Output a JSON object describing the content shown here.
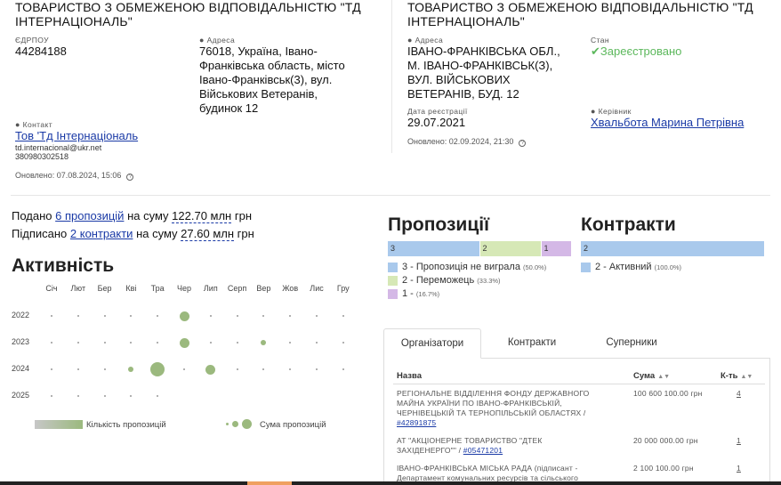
{
  "left_company": {
    "name_line1": "ТОВАРИСТВО З ОБМЕЖЕНОЮ ВІДПОВІДАЛЬНІСТЮ \"ТД",
    "name_line2": "ІНТЕРНАЦІОНАЛЬ\"",
    "edrpou_label": "ЄДРПОУ",
    "edrpou": "44284188",
    "address_label": "Адреса",
    "address_lines": [
      "76018, Україна, Івано-",
      "Франківська область, місто",
      "Івано-Франківськ(3), вул.",
      "Військових Ветеранів,",
      "будинок 12"
    ],
    "contact_label": "Контакт",
    "contact_name": "Тов 'Тд Інтернаціональ",
    "contact_email": "td.internacional@ukr.net",
    "contact_phone": "380980302518",
    "updated": "Оновлено: 07.08.2024, 15:06"
  },
  "right_company": {
    "name_line1": "ТОВАРИСТВО З ОБМЕЖЕНОЮ ВІДПОВІДАЛЬНІСТЮ \"ТД",
    "name_line2": "ІНТЕРНАЦІОНАЛЬ\"",
    "address_label": "Адреса",
    "address_lines": [
      "ІВАНО-ФРАНКІВСЬКА ОБЛ.,",
      "М. ІВАНО-ФРАНКІВСЬК(З),",
      "ВУЛ. ВІЙСЬКОВИХ",
      "ВЕТЕРАНІВ, БУД. 12"
    ],
    "status_label": "Стан",
    "status": "Зареєстровано",
    "reg_date_label": "Дата реєстрації",
    "reg_date": "29.07.2021",
    "head_label": "Керівник",
    "head": "Хвальбота Марина Петрівна",
    "updated": "Оновлено: 02.09.2024, 21:30"
  },
  "summary": {
    "submitted_prefix": "Подано",
    "submitted_link": "6 пропозицій",
    "submitted_mid": "на суму",
    "submitted_sum": "122.70 млн",
    "submitted_unit": "грн",
    "signed_prefix": "Підписано",
    "signed_link": "2 контракти",
    "signed_mid": "на суму",
    "signed_sum": "27.60 млн",
    "signed_unit": "грн"
  },
  "activity": {
    "title": "Активність",
    "months": [
      "Січ",
      "Лют",
      "Бер",
      "Кві",
      "Тра",
      "Чер",
      "Лип",
      "Серп",
      "Вер",
      "Жов",
      "Лис",
      "Гру"
    ],
    "years": [
      "2022",
      "2023",
      "2024",
      "2025"
    ],
    "legend_count": "Кількість пропозицій",
    "legend_sum": "Сума пропозицій",
    "bubbles": [
      {
        "year": "2022",
        "month": "Чер",
        "size": 2
      },
      {
        "year": "2023",
        "month": "Чер",
        "size": 2
      },
      {
        "year": "2023",
        "month": "Вер",
        "size": 1
      },
      {
        "year": "2024",
        "month": "Кві",
        "size": 1
      },
      {
        "year": "2024",
        "month": "Тра",
        "size": 3
      },
      {
        "year": "2024",
        "month": "Лип",
        "size": 2
      }
    ]
  },
  "proposals": {
    "title": "Пропозиції",
    "segments": [
      {
        "count": "3",
        "value": 3,
        "color": "#a9c9ec"
      },
      {
        "count": "2",
        "value": 2,
        "color": "#d6e8b6"
      },
      {
        "count": "1",
        "value": 1,
        "color": "#d4b8e6"
      }
    ],
    "legend": [
      {
        "text": "3 - Пропозиція не виграла",
        "pct": "(50.0%)",
        "color": "#a9c9ec"
      },
      {
        "text": "2 - Переможець",
        "pct": "(33.3%)",
        "color": "#d6e8b6"
      },
      {
        "text": "1 -",
        "pct": "(16.7%)",
        "color": "#d4b8e6"
      }
    ]
  },
  "contracts": {
    "title": "Контракти",
    "segments": [
      {
        "count": "2",
        "value": 2,
        "color": "#a9c9ec"
      }
    ],
    "legend": [
      {
        "text": "2 - Активний",
        "pct": "(100.0%)",
        "color": "#a9c9ec"
      }
    ]
  },
  "tabs": [
    "Організатори",
    "Контракти",
    "Суперники"
  ],
  "table": {
    "headers": {
      "name": "Назва",
      "sum": "Сума",
      "count": "К-ть"
    },
    "rows": [
      {
        "name_lines": [
          "РЕГІОНАЛЬНЕ ВІДДІЛЕННЯ ФОНДУ ДЕРЖАВНОГО",
          "МАЙНА УКРАЇНИ ПО ІВАНО-ФРАНКІВСЬКІЙ,",
          "ЧЕРНІВЕЦЬКІЙ ТА ТЕРНОПІЛЬСЬКІЙ ОБЛАСТЯХ /"
        ],
        "code": "#42891875",
        "sum": "100 600 100.00 грн",
        "count": "4"
      },
      {
        "name_lines": [
          "АТ \"АКЦІОНЕРНЕ ТОВАРИСТВО \"ДТЕК",
          "ЗАХІДЕНЕРГО\"\" /"
        ],
        "code": "#05471201",
        "sum": "20 000 000.00 грн",
        "count": "1"
      },
      {
        "name_lines": [
          "ІВАНО-ФРАНКІВСЬКА МІСЬКА РАДА (підписант -",
          "Департамент комунальних ресурсів та сільського"
        ],
        "code": "",
        "sum": "2 100 100.00 грн",
        "count": "1"
      }
    ]
  }
}
